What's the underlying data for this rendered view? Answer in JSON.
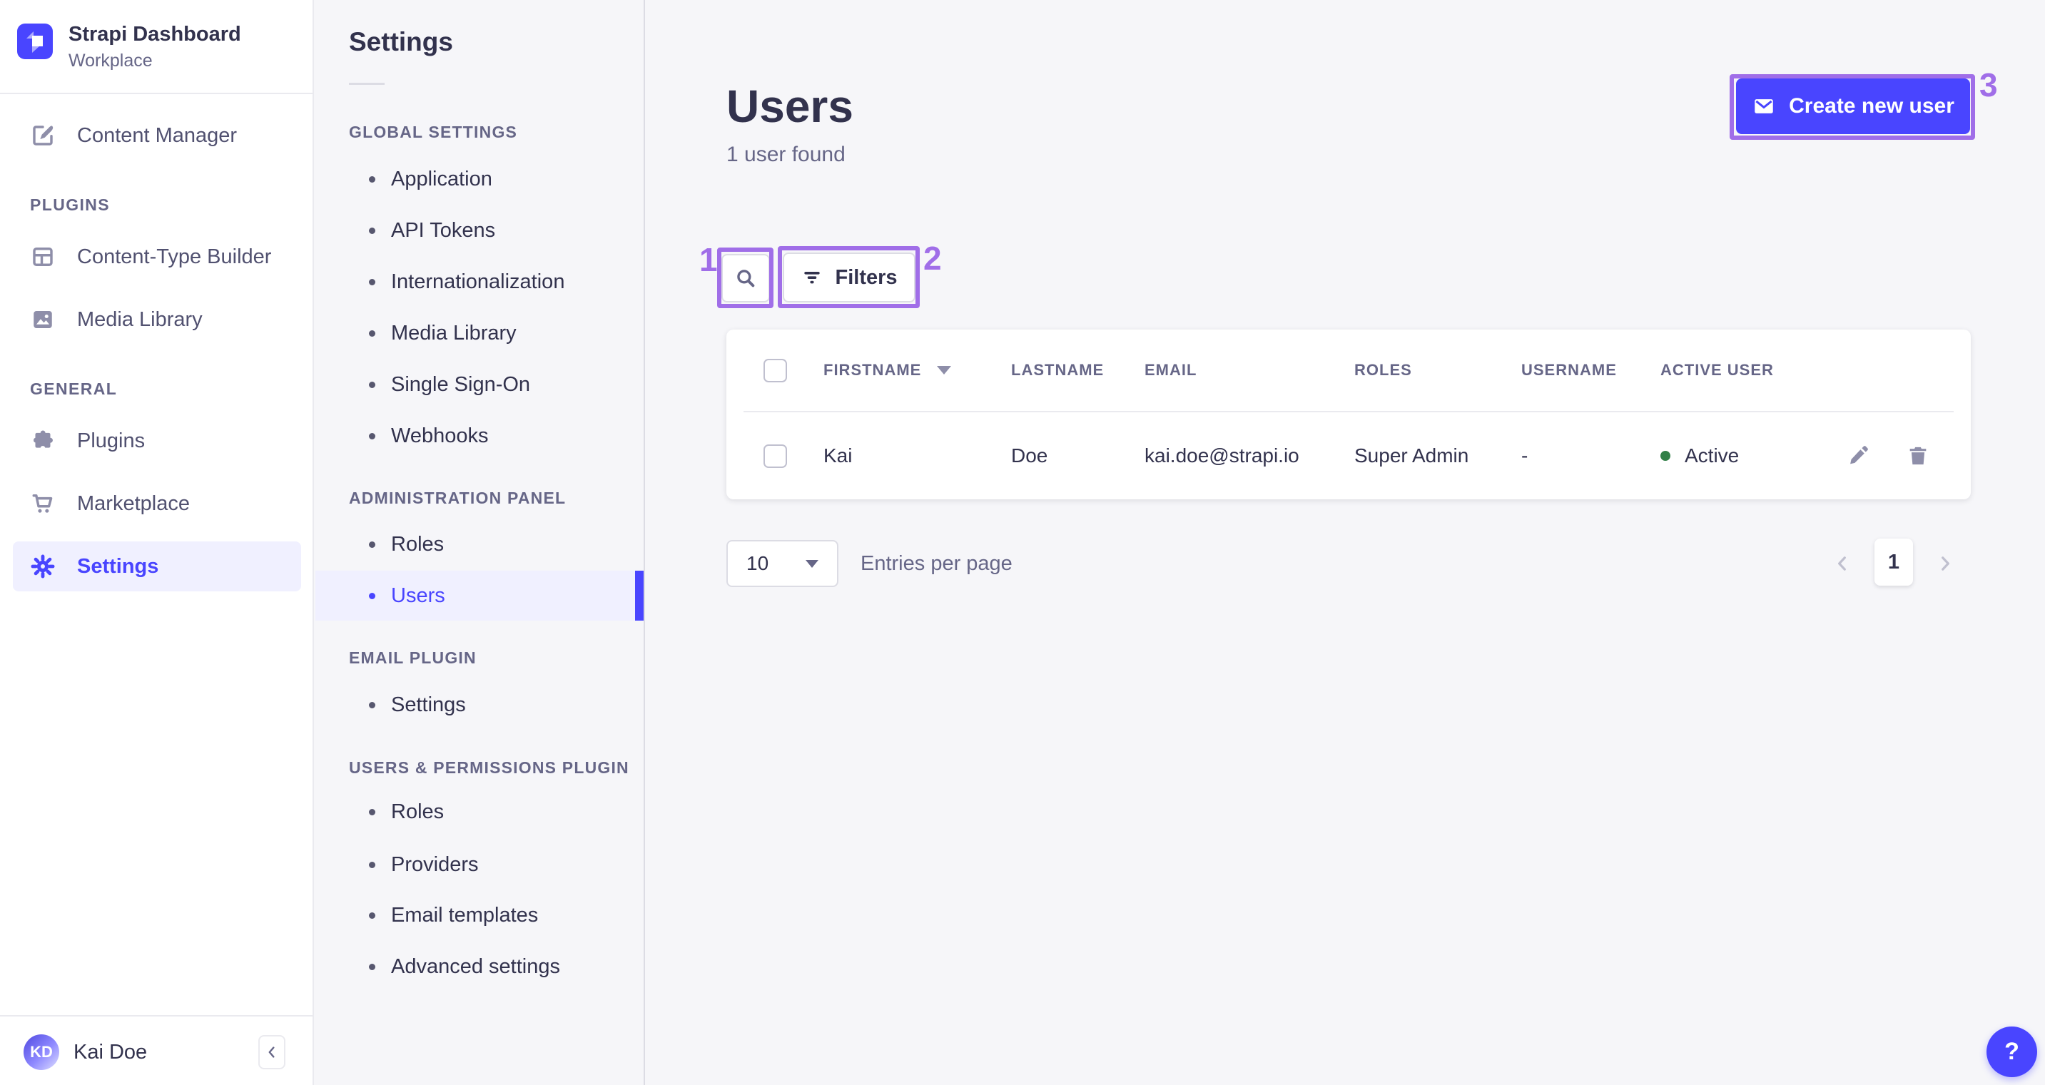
{
  "brand": {
    "name": "Strapi Dashboard",
    "workspace": "Workplace"
  },
  "sidebar": {
    "content_manager": "Content Manager",
    "plugins_header": "PLUGINS",
    "content_type_builder": "Content-Type Builder",
    "media_library": "Media Library",
    "general_header": "GENERAL",
    "plugins": "Plugins",
    "marketplace": "Marketplace",
    "settings": "Settings",
    "user_initials": "KD",
    "user_name": "Kai Doe"
  },
  "subnav": {
    "title": "Settings",
    "sections": [
      {
        "title": "GLOBAL SETTINGS",
        "items": [
          "Application",
          "API Tokens",
          "Internationalization",
          "Media Library",
          "Single Sign-On",
          "Webhooks"
        ]
      },
      {
        "title": "ADMINISTRATION PANEL",
        "items": [
          "Roles",
          "Users"
        ]
      },
      {
        "title": "EMAIL PLUGIN",
        "items": [
          "Settings"
        ]
      },
      {
        "title": "USERS & PERMISSIONS PLUGIN",
        "items": [
          "Roles",
          "Providers",
          "Email templates",
          "Advanced settings"
        ]
      }
    ],
    "active_item": "Users"
  },
  "main": {
    "title": "Users",
    "subtitle": "1 user found",
    "create_button": "Create new user",
    "filters_button": "Filters",
    "table": {
      "headers": [
        "FIRSTNAME",
        "LASTNAME",
        "EMAIL",
        "ROLES",
        "USERNAME",
        "ACTIVE USER"
      ],
      "rows": [
        {
          "firstname": "Kai",
          "lastname": "Doe",
          "email": "kai.doe@strapi.io",
          "roles": "Super Admin",
          "username": "-",
          "active_status": "Active"
        }
      ]
    },
    "pagination": {
      "entries_value": "10",
      "entries_label": "Entries per page",
      "page": "1"
    }
  },
  "annotations": {
    "labels": [
      "1",
      "2",
      "3"
    ]
  },
  "help": {
    "label": "?"
  },
  "colors": {
    "primary": "#4945ff",
    "annotation": "#a06ee8",
    "success": "#328048",
    "active_bg": "#f0f0ff"
  }
}
